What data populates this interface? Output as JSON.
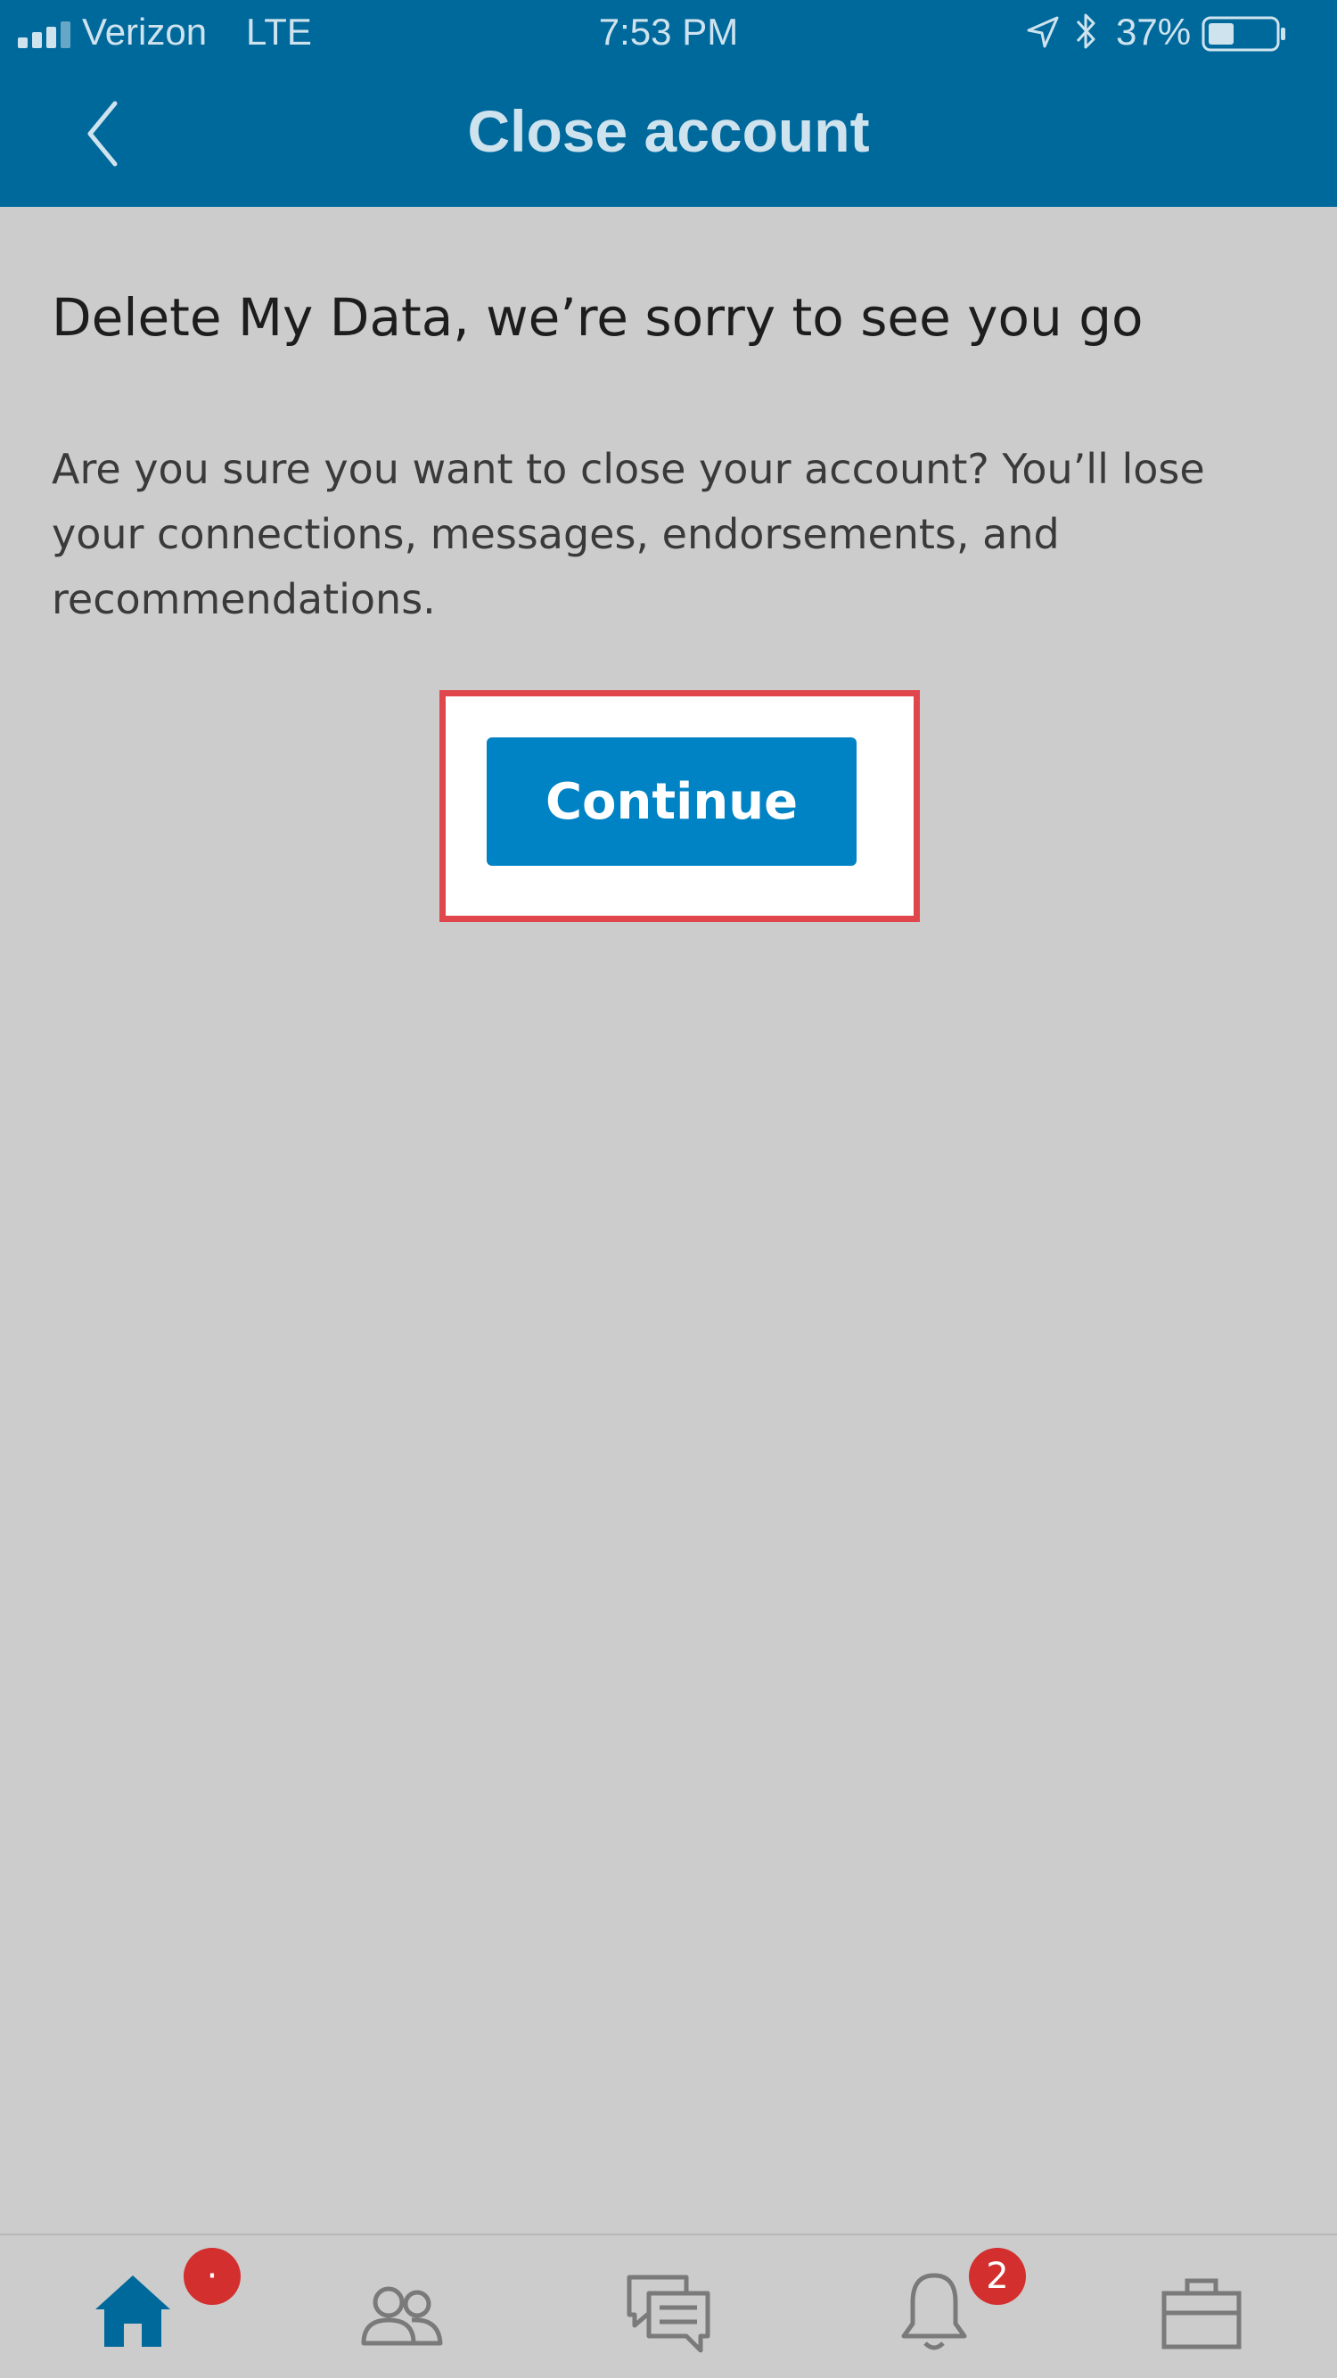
{
  "status_bar": {
    "carrier": "Verizon",
    "network": "LTE",
    "time": "7:53 PM",
    "battery": "37%",
    "icons": [
      "signal-icon",
      "location-arrow-icon",
      "bluetooth-icon",
      "battery-icon"
    ]
  },
  "header": {
    "title": "Close account",
    "back_icon": "chevron-left-icon"
  },
  "content": {
    "heading": "Delete My Data, we’re sorry to see you go",
    "description": "Are you sure you want to close your account? You’ll lose your connections, messages, endorsements, and recommendations.",
    "continue_label": "Continue"
  },
  "bottom_nav": {
    "items": [
      {
        "icon": "home-icon",
        "active": true,
        "badge": "·"
      },
      {
        "icon": "people-icon",
        "active": false
      },
      {
        "icon": "messaging-icon",
        "active": false
      },
      {
        "icon": "bell-icon",
        "active": false,
        "badge": "2"
      },
      {
        "icon": "briefcase-icon",
        "active": false
      }
    ]
  },
  "colors": {
    "header_bg": "#00699c",
    "accent": "#0083c4",
    "highlight": "#e0474c",
    "badge": "#d32f2f",
    "background": "#cccccc"
  }
}
